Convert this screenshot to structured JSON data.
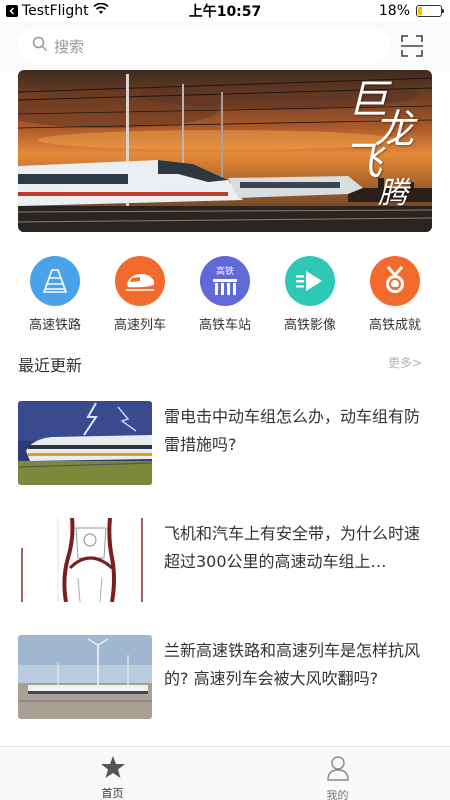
{
  "status_bar": {
    "app_name": "TestFlight",
    "time": "上午10:57",
    "battery": "18%",
    "battery_level": 0.18
  },
  "search": {
    "placeholder": "搜索"
  },
  "banner": {
    "line1": "巨",
    "line2": "龙",
    "line3": "飞",
    "line4": "腾"
  },
  "categories": [
    {
      "label": "高速铁路",
      "icon": "railway-icon",
      "color": "#4aa3e8"
    },
    {
      "label": "高速列车",
      "icon": "train-icon",
      "color": "#f26b2c"
    },
    {
      "label": "高铁车站",
      "icon": "station-icon",
      "color": "#5f6ad8",
      "badge": "高铁"
    },
    {
      "label": "高铁影像",
      "icon": "video-play-icon",
      "color": "#2ec9b5"
    },
    {
      "label": "高铁成就",
      "icon": "medal-icon",
      "color": "#f26b2c"
    }
  ],
  "section": {
    "title": "最近更新",
    "more": "更多>"
  },
  "news": [
    {
      "title": "雷电击中动车组怎么办，动车组有防雷措施吗?"
    },
    {
      "title": "飞机和汽车上有安全带，为什么时速超过300公里的高速动车组上…"
    },
    {
      "title": "兰新高速铁路和高速列车是怎样抗风的? 高速列车会被大风吹翻吗?"
    }
  ],
  "tabbar": {
    "home": "首页",
    "mine": "我的"
  }
}
